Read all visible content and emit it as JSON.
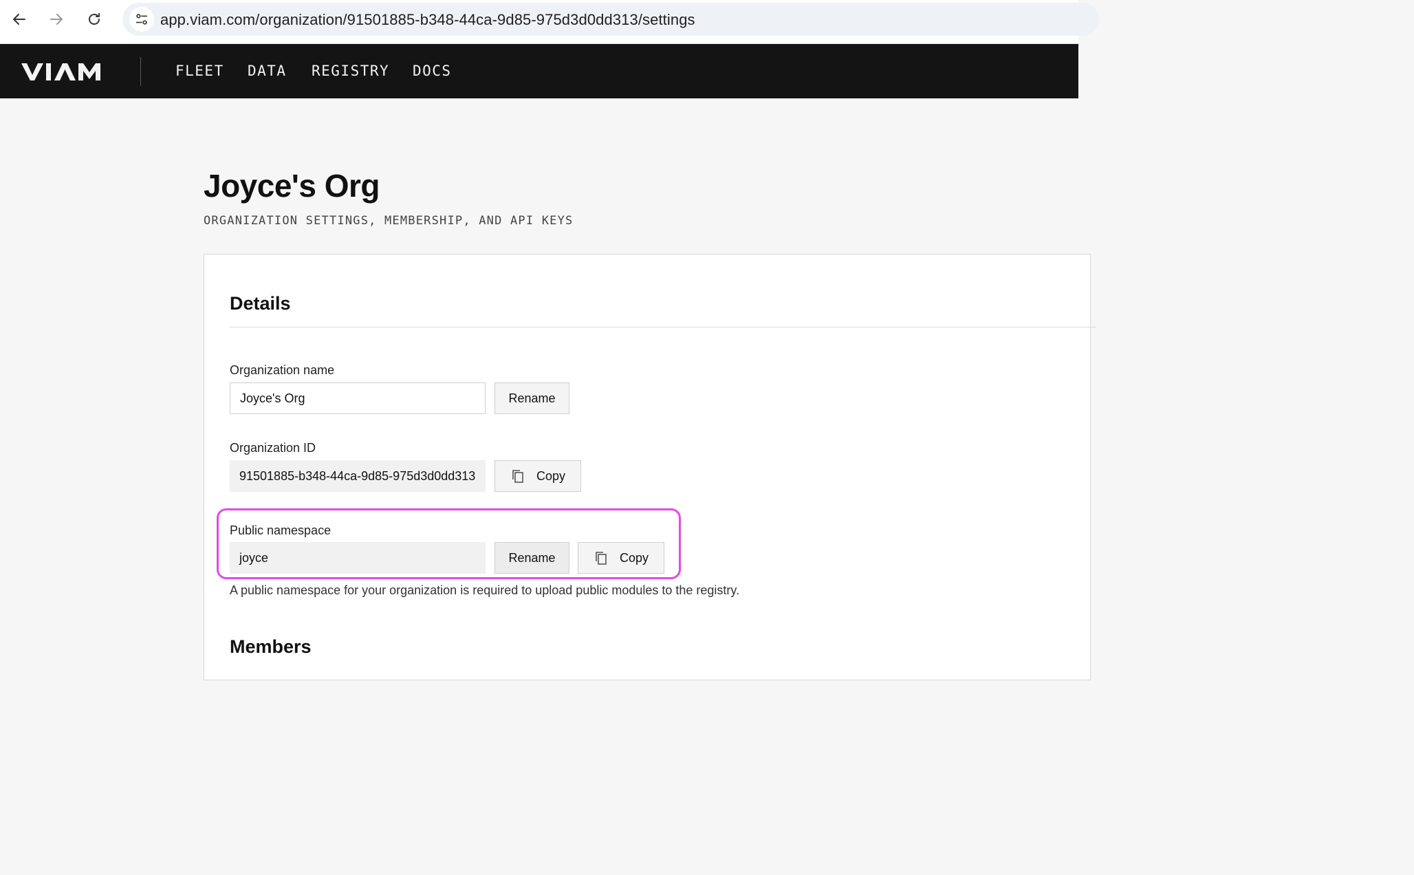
{
  "browser": {
    "url": "app.viam.com/organization/91501885-b348-44ca-9d85-975d3d0dd313/settings"
  },
  "header": {
    "logo_text": "VIAM",
    "nav": [
      "FLEET",
      "DATA",
      "REGISTRY",
      "DOCS"
    ]
  },
  "page": {
    "title": "Joyce's Org",
    "subtitle": "ORGANIZATION SETTINGS, MEMBERSHIP, AND API KEYS"
  },
  "details": {
    "title": "Details",
    "org_name": {
      "label": "Organization name",
      "value": "Joyce's Org",
      "rename_label": "Rename"
    },
    "org_id": {
      "label": "Organization ID",
      "value": "91501885-b348-44ca-9d85-975d3d0dd313",
      "copy_label": "Copy"
    },
    "namespace": {
      "label": "Public namespace",
      "value": "joyce",
      "rename_label": "Rename",
      "copy_label": "Copy",
      "helper": "A public namespace for your organization is required to upload public modules to the registry."
    }
  },
  "members": {
    "title": "Members"
  },
  "colors": {
    "header_bg": "#141414",
    "highlight": "#e04be8"
  }
}
